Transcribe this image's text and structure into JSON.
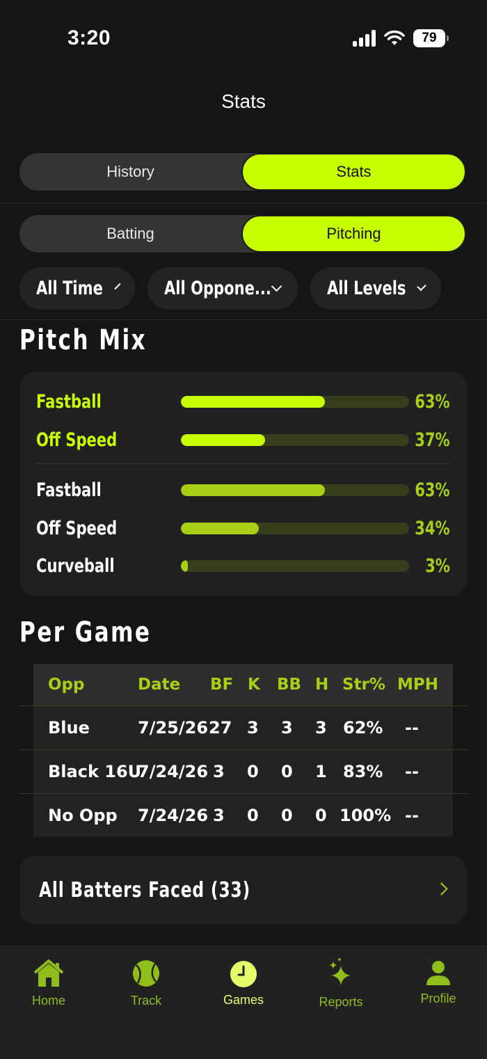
{
  "status": {
    "time": "3:20",
    "battery": "79"
  },
  "title": "Stats",
  "view_tabs": [
    {
      "label": "History",
      "active": false
    },
    {
      "label": "Stats",
      "active": true
    }
  ],
  "mode_tabs": [
    {
      "label": "Batting",
      "active": false
    },
    {
      "label": "Pitching",
      "active": true
    }
  ],
  "filters": [
    "All Time",
    "All Oppone...",
    "All Levels"
  ],
  "pitch_mix": {
    "title": "Pitch Mix",
    "summary": [
      {
        "label": "Fastball",
        "percent": 63
      },
      {
        "label": "Off Speed",
        "percent": 37
      }
    ],
    "detail": [
      {
        "label": "Fastball",
        "percent": 63
      },
      {
        "label": "Off Speed",
        "percent": 34
      },
      {
        "label": "Curveball",
        "percent": 3
      }
    ]
  },
  "per_game": {
    "title": "Per Game",
    "columns": [
      "Opp",
      "Date",
      "BF",
      "K",
      "BB",
      "H",
      "Str%",
      "MPH"
    ],
    "rows": [
      [
        "Blue",
        "7/25/26",
        "27",
        "3",
        "3",
        "3",
        "62%",
        "--"
      ],
      [
        "Black 16U",
        "7/24/26",
        "3",
        "0",
        "0",
        "1",
        "83%",
        "--"
      ],
      [
        "No Opp",
        "7/24/26",
        "3",
        "0",
        "0",
        "0",
        "100%",
        "--"
      ]
    ]
  },
  "batters_faced": {
    "label": "All Batters Faced (33)"
  },
  "tabbar": [
    {
      "label": "Home",
      "icon": "home-icon"
    },
    {
      "label": "Track",
      "icon": "softball-icon"
    },
    {
      "label": "Games",
      "icon": "clock-icon",
      "active": true
    },
    {
      "label": "Reports",
      "icon": "sparkles-icon"
    },
    {
      "label": "Profile",
      "icon": "person-icon"
    }
  ],
  "colors": {
    "accent": "#c8ff00",
    "accent_dim": "#a6cf16",
    "bg": "#151515",
    "card": "#202020"
  }
}
